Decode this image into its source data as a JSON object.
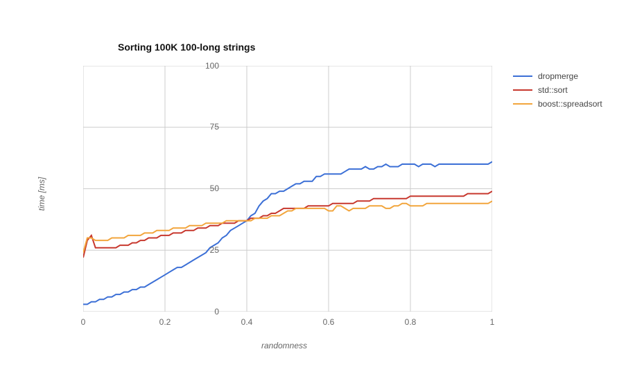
{
  "chart_data": {
    "type": "line",
    "title": "Sorting 100K 100-long strings",
    "xlabel": "randomness",
    "ylabel": "time [ms]",
    "xlim": [
      0,
      1
    ],
    "ylim": [
      0,
      100
    ],
    "xticks": [
      0,
      0.2,
      0.4,
      0.6,
      0.8,
      1
    ],
    "yticks": [
      0,
      25,
      50,
      75,
      100
    ],
    "grid": true,
    "legend_position": "right",
    "x": [
      0.0,
      0.01,
      0.02,
      0.03,
      0.04,
      0.05,
      0.06,
      0.07,
      0.08,
      0.09,
      0.1,
      0.11,
      0.12,
      0.13,
      0.14,
      0.15,
      0.16,
      0.17,
      0.18,
      0.19,
      0.2,
      0.21,
      0.22,
      0.23,
      0.24,
      0.25,
      0.26,
      0.27,
      0.28,
      0.29,
      0.3,
      0.31,
      0.32,
      0.33,
      0.34,
      0.35,
      0.36,
      0.37,
      0.38,
      0.39,
      0.4,
      0.41,
      0.42,
      0.43,
      0.44,
      0.45,
      0.46,
      0.47,
      0.48,
      0.49,
      0.5,
      0.51,
      0.52,
      0.53,
      0.54,
      0.55,
      0.56,
      0.57,
      0.58,
      0.59,
      0.6,
      0.61,
      0.62,
      0.63,
      0.64,
      0.65,
      0.66,
      0.67,
      0.68,
      0.69,
      0.7,
      0.71,
      0.72,
      0.73,
      0.74,
      0.75,
      0.76,
      0.77,
      0.78,
      0.79,
      0.8,
      0.81,
      0.82,
      0.83,
      0.84,
      0.85,
      0.86,
      0.87,
      0.88,
      0.89,
      0.9,
      0.91,
      0.92,
      0.93,
      0.94,
      0.95,
      0.96,
      0.97,
      0.98,
      0.99,
      1.0
    ],
    "series": [
      {
        "name": "dropmerge",
        "color": "#3b6fd6",
        "values": [
          3,
          3,
          4,
          4,
          5,
          5,
          6,
          6,
          7,
          7,
          8,
          8,
          9,
          9,
          10,
          10,
          11,
          12,
          13,
          14,
          15,
          16,
          17,
          18,
          18,
          19,
          20,
          21,
          22,
          23,
          24,
          26,
          27,
          28,
          30,
          31,
          33,
          34,
          35,
          36,
          37,
          39,
          40,
          43,
          45,
          46,
          48,
          48,
          49,
          49,
          50,
          51,
          52,
          52,
          53,
          53,
          53,
          55,
          55,
          56,
          56,
          56,
          56,
          56,
          57,
          58,
          58,
          58,
          58,
          59,
          58,
          58,
          59,
          59,
          60,
          59,
          59,
          59,
          60,
          60,
          60,
          60,
          59,
          60,
          60,
          60,
          59,
          60,
          60,
          60,
          60,
          60,
          60,
          60,
          60,
          60,
          60,
          60,
          60,
          60,
          61
        ]
      },
      {
        "name": "std::sort",
        "color": "#c7372d",
        "values": [
          22,
          29,
          31,
          26,
          26,
          26,
          26,
          26,
          26,
          27,
          27,
          27,
          28,
          28,
          29,
          29,
          30,
          30,
          30,
          31,
          31,
          31,
          32,
          32,
          32,
          33,
          33,
          33,
          34,
          34,
          34,
          35,
          35,
          35,
          36,
          36,
          36,
          36,
          37,
          37,
          37,
          38,
          38,
          38,
          39,
          39,
          40,
          40,
          41,
          42,
          42,
          42,
          42,
          42,
          42,
          43,
          43,
          43,
          43,
          43,
          43,
          44,
          44,
          44,
          44,
          44,
          44,
          45,
          45,
          45,
          45,
          46,
          46,
          46,
          46,
          46,
          46,
          46,
          46,
          46,
          47,
          47,
          47,
          47,
          47,
          47,
          47,
          47,
          47,
          47,
          47,
          47,
          47,
          47,
          48,
          48,
          48,
          48,
          48,
          48,
          49
        ]
      },
      {
        "name": "boost::spreadsort",
        "color": "#f2a53c",
        "values": [
          24,
          30,
          30,
          29,
          29,
          29,
          29,
          30,
          30,
          30,
          30,
          31,
          31,
          31,
          31,
          32,
          32,
          32,
          33,
          33,
          33,
          33,
          34,
          34,
          34,
          34,
          35,
          35,
          35,
          35,
          36,
          36,
          36,
          36,
          36,
          37,
          37,
          37,
          37,
          37,
          37,
          37,
          38,
          38,
          38,
          38,
          39,
          39,
          39,
          40,
          41,
          41,
          42,
          42,
          42,
          42,
          42,
          42,
          42,
          42,
          41,
          41,
          43,
          43,
          42,
          41,
          42,
          42,
          42,
          42,
          43,
          43,
          43,
          43,
          42,
          42,
          43,
          43,
          44,
          44,
          43,
          43,
          43,
          43,
          44,
          44,
          44,
          44,
          44,
          44,
          44,
          44,
          44,
          44,
          44,
          44,
          44,
          44,
          44,
          44,
          45
        ]
      }
    ]
  }
}
